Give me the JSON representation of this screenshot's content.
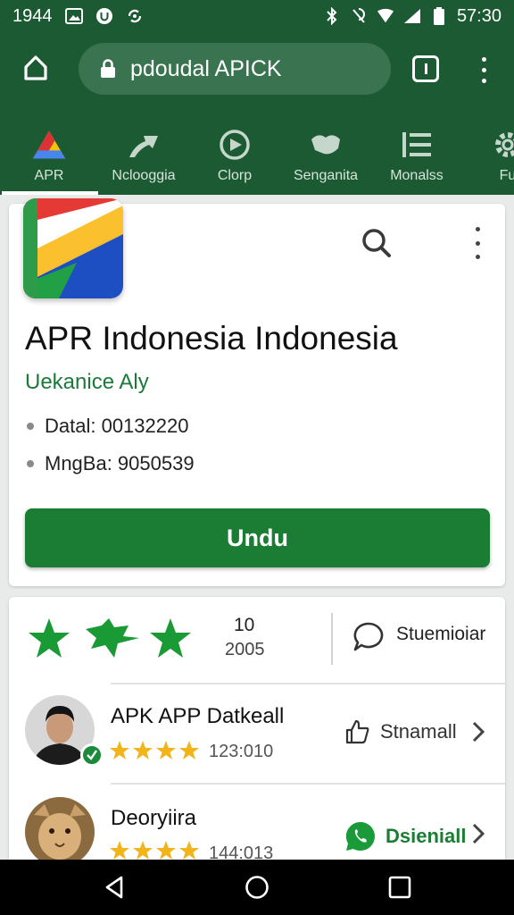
{
  "status": {
    "time_left": "1944",
    "time_right": "57:30"
  },
  "browser": {
    "url": "pdoudal APICK"
  },
  "categories": [
    {
      "label": "APR",
      "icon": "app-logo-icon",
      "active": true
    },
    {
      "label": "Nclooggia",
      "icon": "arrow-swoosh-icon"
    },
    {
      "label": "Clorp",
      "icon": "play-circle-icon"
    },
    {
      "label": "Senganita",
      "icon": "hands-icon"
    },
    {
      "label": "Monalss",
      "icon": "list-icon"
    },
    {
      "label": "Fu",
      "icon": "gear-icon"
    }
  ],
  "app": {
    "title": "APR Indonesia Indonesia",
    "developer": "Uekanice Aly",
    "meta": [
      "Datal: 00132220",
      "MngBa: 9050539"
    ],
    "download_label": "Undu"
  },
  "ratings": {
    "num1": "10",
    "num2": "2005",
    "comment_label": "Stuemioiar"
  },
  "reviews": [
    {
      "name": "APK APP Datkeall",
      "count": "123:010",
      "stars": 4,
      "action": "Stnamall",
      "action_icon": "thumb-up-icon"
    },
    {
      "name": "Deoryiira",
      "count": "144:013",
      "stars": 4,
      "action": "Dsieniall",
      "action_icon": "whatsapp-icon"
    }
  ],
  "colors": {
    "header_green": "#1c5a34",
    "accent_green": "#1b7d33",
    "star_gold": "#f2b41b"
  }
}
